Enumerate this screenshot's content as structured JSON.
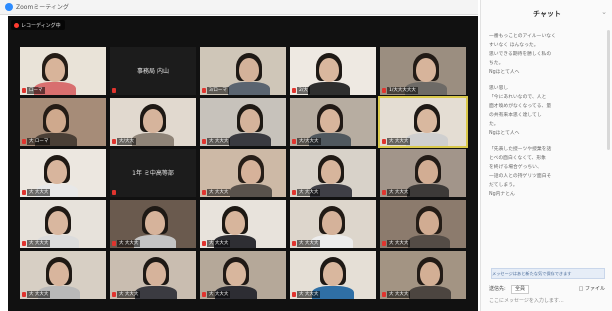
{
  "window": {
    "title": "Zoomミーティング"
  },
  "recording": {
    "label": "レコーディング中"
  },
  "tiles": [
    {
      "type": "person",
      "label": "ローマ",
      "wall": "#e9e3d8",
      "skin": "#d8b49a",
      "hair": "#241c16",
      "shirt": "#d86f6f",
      "active": false
    },
    {
      "type": "blank",
      "label": "",
      "blank_name": "事務局 内山",
      "active": false
    },
    {
      "type": "person",
      "label": "3/ローマ",
      "wall": "#cfc6b8",
      "skin": "#d4b29a",
      "hair": "#1e1915",
      "shirt": "#5a6470",
      "active": false
    },
    {
      "type": "person",
      "label": "2/大",
      "wall": "#eee9e2",
      "skin": "#d9b79e",
      "hair": "#1e1915",
      "shirt": "#2e2e2e",
      "active": false
    },
    {
      "type": "person",
      "label": "1/大大大大大",
      "wall": "#9b8e80",
      "skin": "#d7b49b",
      "hair": "#221b16",
      "shirt": "#6d6a66",
      "active": false
    },
    {
      "type": "person",
      "label": "大 ローマ",
      "wall": "#a68c78",
      "skin": "#cfa98d",
      "hair": "#241c16",
      "shirt": "#4a3f36",
      "active": false
    },
    {
      "type": "person",
      "label": "大/大大",
      "wall": "#e1d9cf",
      "skin": "#d6b49c",
      "hair": "#1e1915",
      "shirt": "#8f8478",
      "active": false
    },
    {
      "type": "person",
      "label": "大 大大大",
      "wall": "#c7c2bb",
      "skin": "#d5b39b",
      "hair": "#1d1813",
      "shirt": "#3a3a40",
      "active": false
    },
    {
      "type": "person",
      "label": "大/大大大",
      "wall": "#b7ada1",
      "skin": "#d8b59c",
      "hair": "#201915",
      "shirt": "#50585e",
      "active": false
    },
    {
      "type": "person",
      "label": "大 大大大",
      "wall": "#e4ddd3",
      "skin": "#d9b89f",
      "hair": "#1e1915",
      "shirt": "#cfcfcf",
      "active": true
    },
    {
      "type": "person",
      "label": "大 大大大",
      "wall": "#ece7e0",
      "skin": "#d8b59d",
      "hair": "#1f1914",
      "shirt": "#e8e8e8",
      "active": false
    },
    {
      "type": "blank",
      "label": "",
      "blank_name": "1年 ミ中高等部",
      "active": false
    },
    {
      "type": "person",
      "label": "大 大大大",
      "wall": "#cdb9a6",
      "skin": "#d6b29a",
      "hair": "#261d17",
      "shirt": "#59524c",
      "active": false
    },
    {
      "type": "person",
      "label": "大 大大大",
      "wall": "#d8d2c9",
      "skin": "#d7b59c",
      "hair": "#1f1914",
      "shirt": "#3f3f46",
      "active": false
    },
    {
      "type": "person",
      "label": "大 大大大",
      "wall": "#a2958a",
      "skin": "#d2ad93",
      "hair": "#221b16",
      "shirt": "#3d3a38",
      "active": false
    },
    {
      "type": "person",
      "label": "大 大大大",
      "wall": "#e7e2db",
      "skin": "#d9b79f",
      "hair": "#1f1914",
      "shirt": "#dcdcdc",
      "active": false
    },
    {
      "type": "person",
      "label": "大 大大大",
      "wall": "#6a5a4e",
      "skin": "#d6b39b",
      "hair": "#1e1915",
      "shirt": "#c4c4c4",
      "active": false
    },
    {
      "type": "person",
      "label": "大 大大大",
      "wall": "#e8e3dc",
      "skin": "#d7b59c",
      "hair": "#1d1813",
      "shirt": "#2e2e33",
      "active": false
    },
    {
      "type": "person",
      "label": "大 大大大",
      "wall": "#ddd6cc",
      "skin": "#d5b29a",
      "hair": "#211a15",
      "shirt": "#ededed",
      "active": false
    },
    {
      "type": "person",
      "label": "大 大大大",
      "wall": "#8c7b6d",
      "skin": "#d1ac92",
      "hair": "#241c16",
      "shirt": "#544c46",
      "active": false
    },
    {
      "type": "person",
      "label": "大 大大大",
      "wall": "#d7cfc4",
      "skin": "#d8b59d",
      "hair": "#1f1914",
      "shirt": "#b9b9b9",
      "active": false
    },
    {
      "type": "person",
      "label": "大 大大大",
      "wall": "#c9bdb0",
      "skin": "#d6b39b",
      "hair": "#1e1915",
      "shirt": "#3b3b41",
      "active": false
    },
    {
      "type": "person",
      "label": "大 大大大",
      "wall": "#b5a899",
      "skin": "#d8b69d",
      "hair": "#201915",
      "shirt": "#2d2d33",
      "active": false
    },
    {
      "type": "person",
      "label": "大 大大大",
      "wall": "#e5dfd6",
      "skin": "#d9b79e",
      "hair": "#1e1915",
      "shirt": "#2f6fa5",
      "active": false
    },
    {
      "type": "person",
      "label": "大 大大大",
      "wall": "#a39483",
      "skin": "#d3af95",
      "hair": "#221b16",
      "shirt": "#4c4540",
      "active": false
    }
  ],
  "chat": {
    "title": "チャット",
    "messages": [
      {
        "lines": [
          "一番もっことのアイルーいなく",
          "すいなく ほんなった。",
          "思いできる期待を勝しく私の",
          "ちた。",
          "Ngほとて人へ"
        ]
      },
      {
        "lines": [
          "思い思し",
          "「今にあれいなので、人と",
          "面才喚めがなくなってる、量",
          "の共有来本思く達してし",
          "た。",
          "Ngほとて人へ"
        ]
      },
      {
        "lines": [
          "「先表した授ーツや授業を話",
          "とべの面白くなくて、形象",
          "を終げる場合ゲっちい、",
          "一話の人との持ゲリツ面白そ",
          "だてしまう。",
          "Ng内ナとん"
        ]
      }
    ],
    "notice": "メッセージはあと新たな気で保存できます",
    "to_label": "送信先:",
    "to_value": "全員",
    "file_label": "ファイル",
    "input_placeholder": "ここにメッセージを入力します..."
  }
}
